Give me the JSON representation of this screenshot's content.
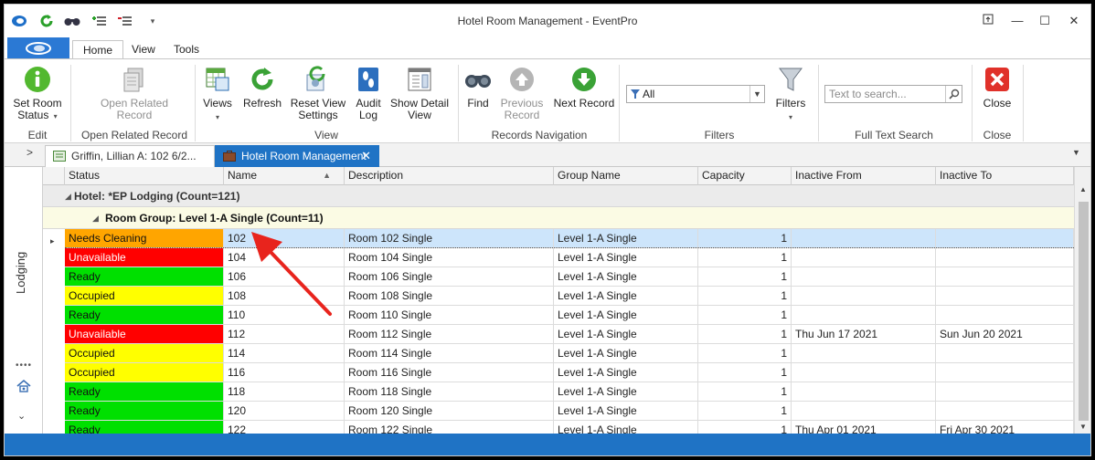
{
  "window": {
    "title": "Hotel Room Management - EventPro"
  },
  "ribbon": {
    "tabs": [
      "Home",
      "View",
      "Tools"
    ],
    "buttons": {
      "set_room_status": "Set Room\nStatus",
      "open_related_record": "Open Related\nRecord",
      "views": "Views",
      "refresh": "Refresh",
      "reset_view_settings": "Reset View\nSettings",
      "audit_log": "Audit\nLog",
      "show_detail_view": "Show Detail\nView",
      "find": "Find",
      "previous_record": "Previous\nRecord",
      "next_record": "Next Record",
      "filters": "Filters",
      "close": "Close"
    },
    "groups": {
      "edit": "Edit",
      "open_related_record": "Open Related Record",
      "view": "View",
      "records_navigation": "Records Navigation",
      "filters": "Filters",
      "full_text_search": "Full Text Search",
      "close": "Close"
    },
    "filter_value": "All",
    "search_placeholder": "Text to search..."
  },
  "doc_tabs": [
    {
      "label": "Griffin, Lillian A: 102 6/2..."
    },
    {
      "label": "Hotel Room Management"
    }
  ],
  "left_rail": {
    "label": "Lodging"
  },
  "grid": {
    "columns": [
      "Status",
      "Name",
      "Description",
      "Group Name",
      "Capacity",
      "Inactive From",
      "Inactive To"
    ],
    "group_hotel": "Hotel: *EP Lodging (Count=121)",
    "group_room": "Room Group: Level 1-A Single (Count=11)",
    "rows": [
      {
        "status": "Needs Cleaning",
        "status_color": "#ffa500",
        "status_text_color": "#111111",
        "name": "102",
        "description": "Room 102 Single",
        "group": "Level 1-A Single",
        "capacity": "1",
        "inactive_from": "",
        "inactive_to": ""
      },
      {
        "status": "Unavailable",
        "status_color": "#ff0000",
        "status_text_color": "#ffffff",
        "name": "104",
        "description": "Room 104 Single",
        "group": "Level 1-A Single",
        "capacity": "1",
        "inactive_from": "",
        "inactive_to": ""
      },
      {
        "status": "Ready",
        "status_color": "#00e000",
        "status_text_color": "#111111",
        "name": "106",
        "description": "Room 106 Single",
        "group": "Level 1-A Single",
        "capacity": "1",
        "inactive_from": "",
        "inactive_to": ""
      },
      {
        "status": "Occupied",
        "status_color": "#ffff00",
        "status_text_color": "#111111",
        "name": "108",
        "description": "Room 108 Single",
        "group": "Level 1-A Single",
        "capacity": "1",
        "inactive_from": "",
        "inactive_to": ""
      },
      {
        "status": "Ready",
        "status_color": "#00e000",
        "status_text_color": "#111111",
        "name": "110",
        "description": "Room 110 Single",
        "group": "Level 1-A Single",
        "capacity": "1",
        "inactive_from": "",
        "inactive_to": ""
      },
      {
        "status": "Unavailable",
        "status_color": "#ff0000",
        "status_text_color": "#ffffff",
        "name": "112",
        "description": "Room 112 Single",
        "group": "Level 1-A Single",
        "capacity": "1",
        "inactive_from": "Thu Jun 17 2021",
        "inactive_to": "Sun Jun 20 2021"
      },
      {
        "status": "Occupied",
        "status_color": "#ffff00",
        "status_text_color": "#111111",
        "name": "114",
        "description": "Room 114 Single",
        "group": "Level 1-A Single",
        "capacity": "1",
        "inactive_from": "",
        "inactive_to": ""
      },
      {
        "status": "Occupied",
        "status_color": "#ffff00",
        "status_text_color": "#111111",
        "name": "116",
        "description": "Room 116 Single",
        "group": "Level 1-A Single",
        "capacity": "1",
        "inactive_from": "",
        "inactive_to": ""
      },
      {
        "status": "Ready",
        "status_color": "#00e000",
        "status_text_color": "#111111",
        "name": "118",
        "description": "Room 118 Single",
        "group": "Level 1-A Single",
        "capacity": "1",
        "inactive_from": "",
        "inactive_to": ""
      },
      {
        "status": "Ready",
        "status_color": "#00e000",
        "status_text_color": "#111111",
        "name": "120",
        "description": "Room 120 Single",
        "group": "Level 1-A Single",
        "capacity": "1",
        "inactive_from": "",
        "inactive_to": ""
      },
      {
        "status": "Ready",
        "status_color": "#00e000",
        "status_text_color": "#111111",
        "name": "122",
        "description": "Room 122 Single",
        "group": "Level 1-A Single",
        "capacity": "1",
        "inactive_from": "Thu Apr 01 2021",
        "inactive_to": "Fri Apr 30 2021"
      }
    ]
  },
  "colors": {
    "accent": "#1f73c5",
    "annotation_arrow": "#e8241d"
  }
}
